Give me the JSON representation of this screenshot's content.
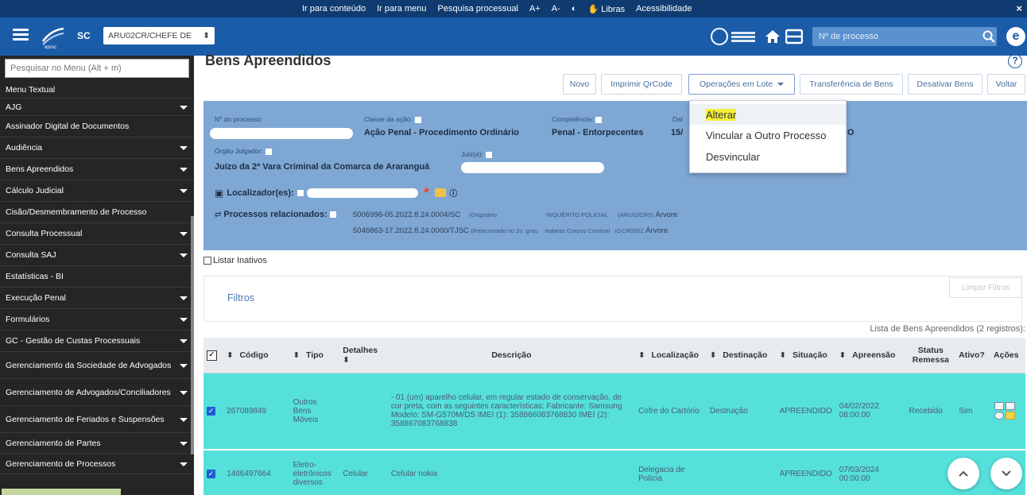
{
  "a11y_bar": {
    "links": [
      "Ir para conteúdo",
      "Ir para menu",
      "Pesquisa processual",
      "A+",
      "A-",
      "◐",
      "Libras",
      "Acessibilidade"
    ],
    "close": "×"
  },
  "header": {
    "state": "SC",
    "profile": "ARU02CR/CHEFE DE",
    "process_search_placeholder": "Nº de processo"
  },
  "sidebar": {
    "search_placeholder": "Pesquisar no Menu (Alt + m)",
    "items": [
      {
        "label": "Menu Textual",
        "caret": false,
        "h": 22
      },
      {
        "label": "AJG",
        "caret": true,
        "h": 22
      },
      {
        "label": "Assinador Digital de Documentos",
        "caret": false,
        "h": 27
      },
      {
        "label": "Audiência",
        "caret": true,
        "h": 27
      },
      {
        "label": "Bens Apreendidos",
        "caret": true,
        "h": 27
      },
      {
        "label": "Cálculo Judicial",
        "caret": true,
        "h": 27
      },
      {
        "label": "Cisão/Desmembramento de Processo",
        "caret": false,
        "h": 27
      },
      {
        "label": "Consulta Processual",
        "caret": true,
        "h": 27
      },
      {
        "label": "Consulta SAJ",
        "caret": true,
        "h": 27
      },
      {
        "label": "Estatísticas - BI",
        "caret": false,
        "h": 27
      },
      {
        "label": "Execução Penal",
        "caret": true,
        "h": 27
      },
      {
        "label": "Formulários",
        "caret": true,
        "h": 27
      },
      {
        "label": "GC - Gestão de Custas Processuais",
        "caret": true,
        "h": 27
      },
      {
        "label": "Gerenciamento da Sociedade de Advogados",
        "caret": true,
        "h": 34
      },
      {
        "label": "Gerenciamento de Advogados/Conciliadores",
        "caret": true,
        "h": 34
      },
      {
        "label": "Gerenciamento de Feriados e Suspensões",
        "caret": true,
        "h": 34
      },
      {
        "label": "Gerenciamento de Partes",
        "caret": true,
        "h": 26
      },
      {
        "label": "Gerenciamento de Processos",
        "caret": true,
        "h": 26
      }
    ]
  },
  "page": {
    "title": "Bens Apreendidos",
    "help": "?"
  },
  "toolbar": {
    "novo": "Novo",
    "imprimir": "Imprimir QrCode",
    "operacoes": "Operações em Lote",
    "transferencia": "Transferência de Bens",
    "desativar": "Desativar Bens",
    "voltar": "Voltar"
  },
  "dropdown": {
    "alterar": "Alterar",
    "vincular": "Vincular a Outro Processo",
    "desvincular": "Desvincular"
  },
  "process": {
    "numero_label": "Nº do processo:",
    "classe_label": "Classe da ação:",
    "classe_value": "Ação Penal - Procedimento Ordinário",
    "competencia_label": "Competência:",
    "competencia_value": "Penal - Entorpecentes",
    "data_label": "Dat",
    "data_value": "15/",
    "extra_value": "O",
    "orgao_label": "Órgão Julgador:",
    "orgao_value": "Juízo da 2ª Vara Criminal da Comarca de Araranguá",
    "juiz_label": "Juiz(a):",
    "localizador_label": "Localizador(es):",
    "relacionados_label": "Processos relacionados:",
    "rel1_num": "5006996-05.2022.8.24.0004/SC",
    "rel1_tipo": "(Originário",
    "rel1_classe": "INQUÉRITO POLICIAL",
    "rel1_loc": "(ARU02CR0)",
    "rel1_arvore": "Árvore",
    "rel2_num": "5046863-17.2022.8.24.0000/TJSC",
    "rel2_tipo": "(Relacionado no 2o. grau",
    "rel2_classe": "Habeas Corpus Criminal",
    "rel2_loc": "(GCR0502",
    "rel2_arvore": "Árvore"
  },
  "filters": {
    "listar_inativos": "Listar Inativos",
    "filtros": "Filtros",
    "limpar": "Limpar Filtros",
    "caption": "Lista de Bens Apreendidos (2 registros):"
  },
  "table": {
    "headers": {
      "codigo": "Código",
      "tipo": "Tipo",
      "detalhes": "Detalhes",
      "descricao": "Descrição",
      "localizacao": "Localização",
      "destinacao": "Destinação",
      "situacao": "Situação",
      "apreensao": "Apreensão",
      "status": "Status Remessa",
      "ativo": "Ativo?",
      "acoes": "Ações"
    },
    "rows": [
      {
        "codigo": "267089849",
        "tipo": "Outros Bens Móveis",
        "detalhes": "",
        "descricao": "- 01 (um) aparelho celular, em regular estado de conservação, de cor preta, com as seguintes características: Fabricante: Samsung Modelo: SM-G570M/DS IMEI (1): 358866083768830 IMEI (2): 358867083768838",
        "localizacao": "Cofre do Cartório",
        "destinacao": "Destruição",
        "situacao": "APREENDIDO",
        "apreensao": "04/02/2022 08:00:00",
        "status": "Recebido",
        "ativo": "Sim"
      },
      {
        "codigo": "1466497664",
        "tipo": "Eletro-eletrônicos diversos",
        "detalhes": "Celular",
        "descricao": "Celular nokia",
        "localizacao": "Delegacia de Polícia",
        "destinacao": "",
        "situacao": "APREENDIDO",
        "apreensao": "07/03/2024 00:00:00",
        "status": "",
        "ativo": ""
      }
    ]
  },
  "colors": {
    "header_blue": "#1a5ca8",
    "accessibility_bar": "#0f3b70",
    "process_panel": "#7ea7d3",
    "selected_row": "#56e0dc",
    "sidebar": "#252525"
  }
}
